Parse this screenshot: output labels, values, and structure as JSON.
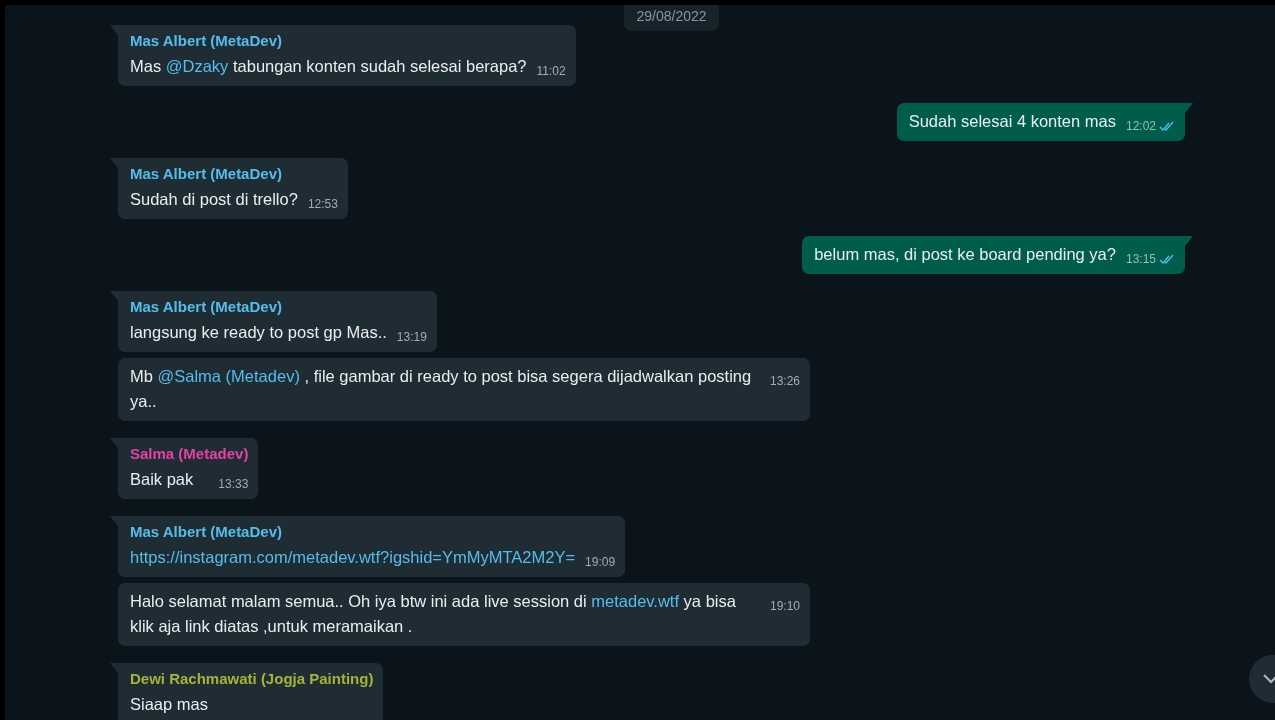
{
  "date_chip": "29/08/2022",
  "messages": [
    {
      "outgoing": false,
      "tail": true,
      "sender": "Mas Albert (MetaDev)",
      "color": "#53bdeb",
      "parts": [
        {
          "kind": "text",
          "text": "Mas "
        },
        {
          "kind": "mention",
          "text": "@Dzaky"
        },
        {
          "kind": "text",
          "text": " tabungan konten sudah selesai berapa?"
        }
      ],
      "time": "11:02"
    },
    {
      "outgoing": true,
      "tail": true,
      "read": true,
      "parts": [
        {
          "kind": "text",
          "text": "Sudah selesai 4 konten mas"
        }
      ],
      "time": "12:02"
    },
    {
      "outgoing": false,
      "tail": true,
      "sender": "Mas Albert (MetaDev)",
      "color": "#53bdeb",
      "parts": [
        {
          "kind": "text",
          "text": "Sudah di post di trello?"
        }
      ],
      "time": "12:53"
    },
    {
      "outgoing": true,
      "tail": true,
      "read": true,
      "parts": [
        {
          "kind": "text",
          "text": "belum mas, di post ke board pending ya?"
        }
      ],
      "time": "13:15"
    },
    {
      "outgoing": false,
      "tail": true,
      "sender": "Mas Albert (MetaDev)",
      "color": "#53bdeb",
      "parts": [
        {
          "kind": "text",
          "text": "langsung ke ready to post gp Mas.."
        }
      ],
      "time": "13:19"
    },
    {
      "outgoing": false,
      "tail": false,
      "parts": [
        {
          "kind": "text",
          "text": "Mb "
        },
        {
          "kind": "mention",
          "text": "@Salma (Metadev)"
        },
        {
          "kind": "text",
          "text": " , file gambar di ready to post bisa segera dijadwalkan posting ya.."
        }
      ],
      "time": "13:26"
    },
    {
      "outgoing": false,
      "tail": true,
      "sender": "Salma (Metadev)",
      "color": "#e542a3",
      "parts": [
        {
          "kind": "text",
          "text": "Baik pak"
        }
      ],
      "time": "13:33"
    },
    {
      "outgoing": false,
      "tail": true,
      "sender": "Mas Albert (MetaDev)",
      "color": "#53bdeb",
      "parts": [
        {
          "kind": "link",
          "text": "https://instagram.com/metadev.wtf?igshid=YmMyMTA2M2Y="
        }
      ],
      "time": "19:09"
    },
    {
      "outgoing": false,
      "tail": false,
      "parts": [
        {
          "kind": "text",
          "text": "Halo selamat malam semua.. Oh iya btw ini ada live session di "
        },
        {
          "kind": "link",
          "text": "metadev.wtf"
        },
        {
          "kind": "text",
          "text": " ya bisa klik aja link diatas ,untuk meramaikan ."
        }
      ],
      "time": "19:10"
    },
    {
      "outgoing": false,
      "tail": true,
      "sender": "Dewi Rachmawati (Jogja Painting)",
      "color": "#a5b337",
      "parts": [
        {
          "kind": "text",
          "text": "Siaap mas"
        }
      ]
    }
  ]
}
